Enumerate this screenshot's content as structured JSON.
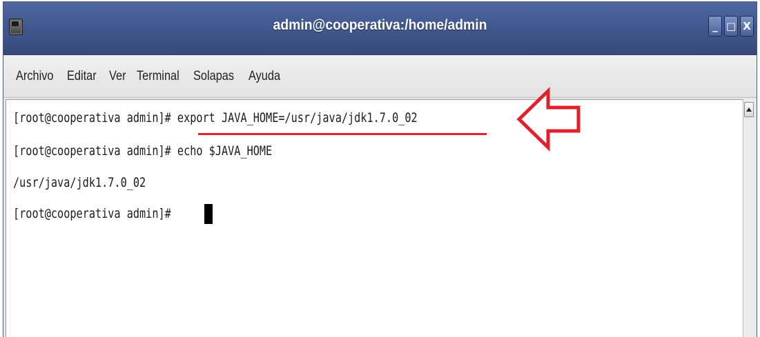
{
  "window": {
    "title": "admin@cooperativa:/home/admin",
    "controls": {
      "minimize": "_",
      "maximize": "□",
      "close": "X"
    }
  },
  "menu": {
    "items": [
      {
        "label": "Archivo"
      },
      {
        "label": "Editar"
      },
      {
        "label": "Ver"
      },
      {
        "label": "Terminal"
      },
      {
        "label": "Solapas"
      },
      {
        "label": "Ayuda"
      }
    ]
  },
  "terminal": {
    "lines": [
      "[root@cooperativa admin]# export JAVA_HOME=/usr/java/jdk1.7.0_02",
      "[root@cooperativa admin]# echo $JAVA_HOME",
      "/usr/java/jdk1.7.0_02",
      "[root@cooperativa admin]# "
    ]
  },
  "annotation": {
    "color": "#e0202a",
    "arrow_icon": "left-arrow-outline-icon"
  }
}
